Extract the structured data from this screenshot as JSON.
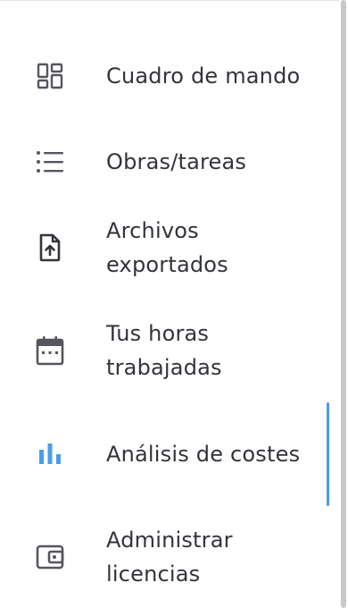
{
  "colors": {
    "text": "#33333a",
    "icon": "#55565e",
    "accent": "#4a9ee8"
  },
  "sidebar": {
    "items": [
      {
        "label": "Cuadro de mando",
        "icon": "dashboard-icon",
        "active": false
      },
      {
        "label": "Obras/tareas",
        "icon": "list-icon",
        "active": false
      },
      {
        "label": "Archivos exportados",
        "icon": "file-upload-icon",
        "active": false
      },
      {
        "label": "Tus horas trabajadas",
        "icon": "calendar-icon",
        "active": false
      },
      {
        "label": "Análisis de costes",
        "icon": "bar-chart-icon",
        "active": true
      },
      {
        "label": "Administrar licencias",
        "icon": "wallet-icon",
        "active": false
      }
    ]
  }
}
